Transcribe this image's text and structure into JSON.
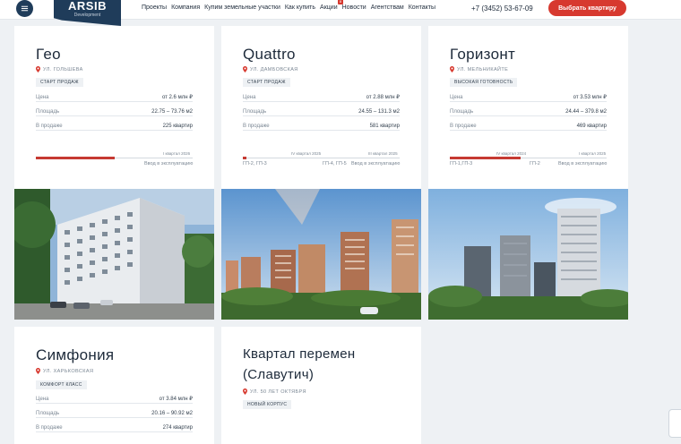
{
  "header": {
    "logo_title": "ARSIB",
    "logo_sub": "Development",
    "nav": [
      "Проекты",
      "Компания",
      "Купим земельные участки",
      "Как купить",
      "Акции",
      "Новости",
      "Агентствам",
      "Контакты"
    ],
    "promo_badge": "8",
    "phone": "+7 (3452) 53-67-09",
    "cta": "Выбрать квартиру"
  },
  "projects": [
    {
      "title": "Гео",
      "address": "УЛ. ГОЛЬШЕВА",
      "badge": "СТАРТ ПРОДАЖ",
      "price_label": "Цена",
      "price": "от 2.6 млн ₽",
      "area_label": "Площадь",
      "area": "22.75 – 73.76 м2",
      "sale_label": "В продаже",
      "sale": "225 квартир",
      "timeline_top": [
        "I квартал 2026"
      ],
      "timeline_progress": 0.5,
      "timeline_bottom": [
        "",
        "Ввод в эксплуатацию"
      ]
    },
    {
      "title": "Quattro",
      "address": "УЛ. ДАМБОВСКАЯ",
      "badge": "СТАРТ ПРОДАЖ",
      "price_label": "Цена",
      "price": "от 2.88 млн ₽",
      "area_label": "Площадь",
      "area": "24.55 – 131.3 м2",
      "sale_label": "В продаже",
      "sale": "581 квартир",
      "timeline_top": [
        "IV квартал 2025",
        "III квартал 2025"
      ],
      "timeline_progress": 0.02,
      "timeline_bottom": [
        "ГП-2, ГП-3",
        "ГП-4, ГП-5",
        "Ввод в эксплуатацию"
      ]
    },
    {
      "title": "Горизонт",
      "address": "УЛ. МЕЛЬНИКАЙТЕ",
      "badge": "ВЫСОКАЯ ГОТОВНОСТЬ",
      "price_label": "Цена",
      "price": "от 3.53 млн ₽",
      "area_label": "Площадь",
      "area": "24.44 – 379.8 м2",
      "sale_label": "В продаже",
      "sale": "469 квартир",
      "timeline_top": [
        "IV квартал 2024",
        "I квартал 2025"
      ],
      "timeline_progress": 0.45,
      "timeline_bottom": [
        "ГП-1,ГП-3",
        "ГП-2",
        "Ввод в эксплуатацию"
      ]
    },
    {
      "title": "Симфония",
      "address": "УЛ. ХАРЬКОВСКАЯ",
      "badge": "КОМФОРТ КЛАСС",
      "price_label": "Цена",
      "price": "от 3.84 млн ₽",
      "area_label": "Площадь",
      "area": "20.16 – 90.92 м2",
      "sale_label": "В продаже",
      "sale": "274 квартир"
    },
    {
      "title_line1": "Квартал перемен",
      "title_line2": "(Славутич)",
      "address": "УЛ. 50 ЛЕТ ОКТЯБРЯ",
      "badge": "НОВЫЙ КОРПУС"
    }
  ],
  "colors": {
    "accent": "#d7392f",
    "brand": "#1f3c5a",
    "progress": "#c63a32"
  }
}
